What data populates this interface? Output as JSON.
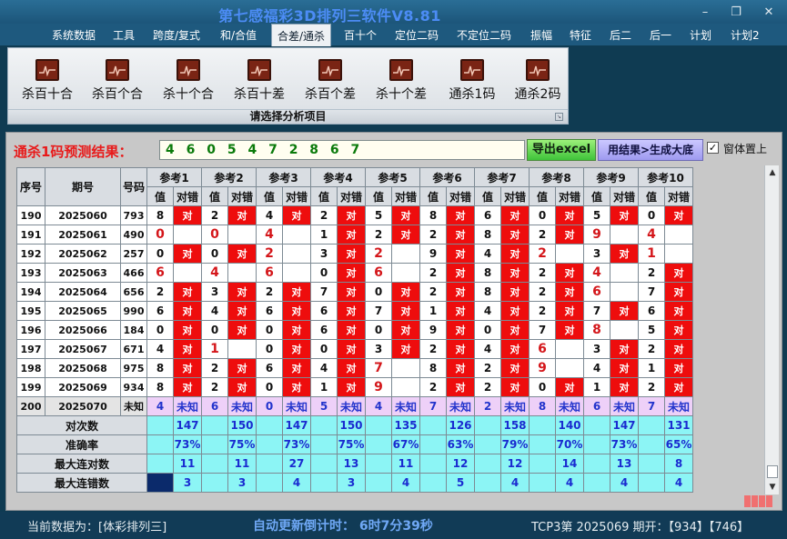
{
  "app": {
    "title": "第七感福彩3D排列三软件V8.81",
    "window_buttons": [
      "–",
      "❐",
      "✕"
    ]
  },
  "menu": {
    "items": [
      "系统数据",
      "工具",
      "跨度/复式",
      "和/合值",
      "合差/通杀",
      "百十个",
      "定位二码",
      "不定位二码",
      "振幅",
      "特征",
      "后二",
      "后一",
      "计划",
      "计划2"
    ],
    "active_index": 4
  },
  "ribbon": {
    "buttons": [
      "杀百十合",
      "杀百个合",
      "杀十个合",
      "杀百十差",
      "杀百个差",
      "杀十个差",
      "通杀1码",
      "通杀2码"
    ],
    "icon": "chart-icon",
    "caption": "请选择分析项目"
  },
  "prediction": {
    "label": "通杀1码预测结果：",
    "value": "4 6 0 5 4 7 2 8 6 7",
    "export_button": "导出excel",
    "generate_button": "用结果>生成大底",
    "window_top_checked": true,
    "window_top_label": "窗体置上"
  },
  "grid": {
    "headers": {
      "seq": "序号",
      "period": "期号",
      "number": "号码",
      "refs": [
        "参考1",
        "参考2",
        "参考3",
        "参考4",
        "参考5",
        "参考6",
        "参考7",
        "参考8",
        "参考9",
        "参考10"
      ],
      "sub_value": "值",
      "sub_result": "对错"
    },
    "ok_text": "对",
    "rows": [
      {
        "seq": "190",
        "period": "2025060",
        "number": "793",
        "vals": [
          "8",
          "2",
          "4",
          "2",
          "5",
          "8",
          "6",
          "0",
          "5",
          "0"
        ],
        "res": [
          1,
          1,
          1,
          1,
          1,
          1,
          1,
          1,
          1,
          1
        ]
      },
      {
        "seq": "191",
        "period": "2025061",
        "number": "490",
        "vals": [
          "0",
          "0",
          "4",
          "1",
          "2",
          "2",
          "8",
          "2",
          "9",
          "4"
        ],
        "res": [
          0,
          0,
          0,
          1,
          1,
          1,
          1,
          1,
          0,
          0
        ]
      },
      {
        "seq": "192",
        "period": "2025062",
        "number": "257",
        "vals": [
          "0",
          "0",
          "2",
          "3",
          "2",
          "9",
          "4",
          "2",
          "3",
          "1"
        ],
        "res": [
          1,
          1,
          0,
          1,
          0,
          1,
          1,
          0,
          1,
          0
        ]
      },
      {
        "seq": "193",
        "period": "2025063",
        "number": "466",
        "vals": [
          "6",
          "4",
          "6",
          "0",
          "6",
          "2",
          "8",
          "2",
          "4",
          "2"
        ],
        "res": [
          0,
          0,
          0,
          1,
          0,
          1,
          1,
          1,
          0,
          1
        ]
      },
      {
        "seq": "194",
        "period": "2025064",
        "number": "656",
        "vals": [
          "2",
          "3",
          "2",
          "7",
          "0",
          "2",
          "8",
          "2",
          "6",
          "7"
        ],
        "res": [
          1,
          1,
          1,
          1,
          1,
          1,
          1,
          1,
          0,
          1
        ]
      },
      {
        "seq": "195",
        "period": "2025065",
        "number": "990",
        "vals": [
          "6",
          "4",
          "6",
          "6",
          "7",
          "1",
          "4",
          "2",
          "7",
          "6"
        ],
        "res": [
          1,
          1,
          1,
          1,
          1,
          1,
          1,
          1,
          1,
          1
        ]
      },
      {
        "seq": "196",
        "period": "2025066",
        "number": "184",
        "vals": [
          "0",
          "0",
          "0",
          "6",
          "0",
          "9",
          "0",
          "7",
          "8",
          "5"
        ],
        "res": [
          1,
          1,
          1,
          1,
          1,
          1,
          1,
          1,
          0,
          1
        ]
      },
      {
        "seq": "197",
        "period": "2025067",
        "number": "671",
        "vals": [
          "4",
          "1",
          "0",
          "0",
          "3",
          "2",
          "4",
          "6",
          "3",
          "2"
        ],
        "res": [
          1,
          0,
          1,
          1,
          1,
          1,
          1,
          0,
          1,
          1
        ]
      },
      {
        "seq": "198",
        "period": "2025068",
        "number": "975",
        "vals": [
          "8",
          "2",
          "6",
          "4",
          "7",
          "8",
          "2",
          "9",
          "4",
          "1"
        ],
        "res": [
          1,
          1,
          1,
          1,
          0,
          1,
          1,
          0,
          1,
          1
        ]
      },
      {
        "seq": "199",
        "period": "2025069",
        "number": "934",
        "vals": [
          "8",
          "2",
          "0",
          "1",
          "9",
          "2",
          "2",
          "0",
          "1",
          "2"
        ],
        "res": [
          1,
          1,
          1,
          1,
          0,
          1,
          1,
          1,
          1,
          1
        ]
      }
    ],
    "pending": {
      "seq": "200",
      "period": "2025070",
      "number": "未知",
      "vals": [
        "4",
        "6",
        "0",
        "5",
        "4",
        "7",
        "2",
        "8",
        "6",
        "7"
      ],
      "res_text": "未知"
    },
    "stats": [
      {
        "label": "对次数",
        "values": [
          "147",
          "150",
          "147",
          "150",
          "135",
          "126",
          "158",
          "140",
          "147",
          "131"
        ]
      },
      {
        "label": "准确率",
        "values": [
          "73%",
          "75%",
          "73%",
          "75%",
          "67%",
          "63%",
          "79%",
          "70%",
          "73%",
          "65%"
        ]
      },
      {
        "label": "最大连对数",
        "values": [
          "11",
          "11",
          "27",
          "13",
          "11",
          "12",
          "12",
          "14",
          "13",
          "8"
        ]
      },
      {
        "label": "最大连错数",
        "values": [
          "3",
          "3",
          "4",
          "3",
          "4",
          "5",
          "4",
          "4",
          "4",
          "4"
        ]
      }
    ]
  },
  "status": {
    "left": "当前数据为：[体彩排列三]",
    "mid": "自动更新倒计时：  6时7分39秒",
    "right": "TCP3第 2025069 期开：【934】【746】"
  }
}
